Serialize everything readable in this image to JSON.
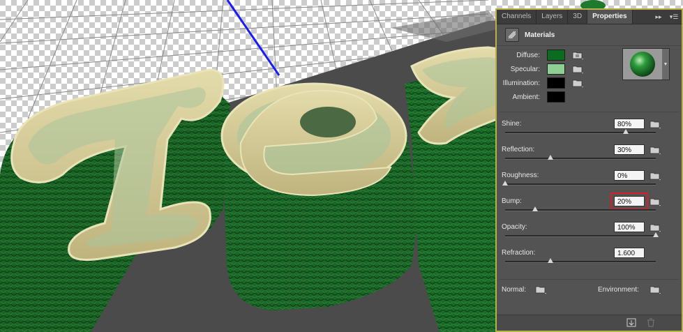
{
  "tabs": [
    "Channels",
    "Layers",
    "3D",
    "Properties"
  ],
  "active_tab": "Properties",
  "materials_title": "Materials",
  "channels": [
    {
      "label": "Diffuse:",
      "color": "#0b6b1f"
    },
    {
      "label": "Specular:",
      "color": "#8fcf96"
    },
    {
      "label": "Illumination:",
      "color": "#000000"
    },
    {
      "label": "Ambient:",
      "color": "#000000"
    }
  ],
  "properties": [
    {
      "label": "Shine:",
      "value": "80%",
      "level": 0.8,
      "highlighted": false
    },
    {
      "label": "Reflection:",
      "value": "30%",
      "level": 0.3,
      "highlighted": false
    },
    {
      "label": "Roughness:",
      "value": "0%",
      "level": 0.0,
      "highlighted": false
    },
    {
      "label": "Bump:",
      "value": "20%",
      "level": 0.2,
      "highlighted": true
    },
    {
      "label": "Opacity:",
      "value": "100%",
      "level": 1.0,
      "highlighted": false
    },
    {
      "label": "Refraction:",
      "value": "1.600",
      "level": 0.3,
      "highlighted": false
    }
  ],
  "bottom": {
    "normal_label": "Normal:",
    "environment_label": "Environment:"
  },
  "colors": {
    "panel_border": "#b8b24a",
    "highlight": "#d52027",
    "text_face": "#c9bf8a",
    "extrusion": "#1f7a2e",
    "axis_line": "#1a1aff"
  },
  "icons": {
    "tab_menu": "panel-menu-icon",
    "collapse": "collapse-icon",
    "materials": "materials-icon",
    "folder": "folder-icon",
    "footer_left": "load-texture-icon",
    "footer_right": "trash-icon"
  }
}
